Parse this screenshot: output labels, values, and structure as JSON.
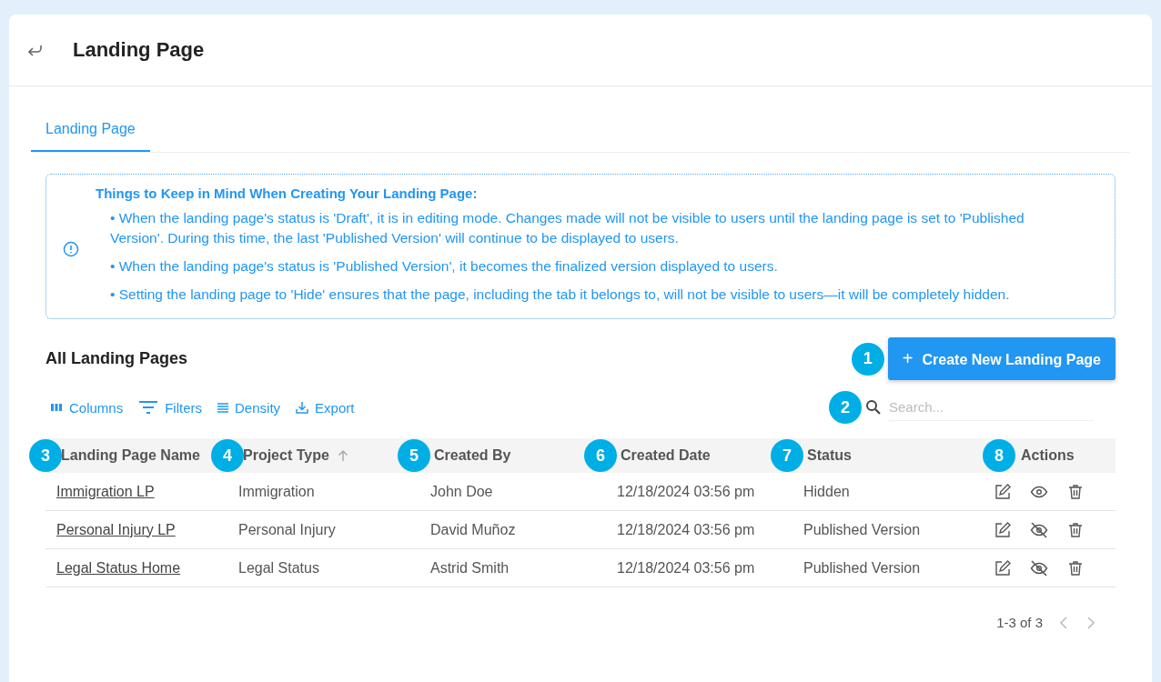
{
  "header": {
    "title": "Landing Page"
  },
  "tabs": [
    {
      "label": "Landing Page",
      "selected": true
    }
  ],
  "notice": {
    "title": "Things to Keep in Mind When Creating Your Landing Page:",
    "items": [
      "• When the landing page's status is 'Draft', it is in editing mode. Changes made will not be visible to users until the landing page is set to 'Published Version'. During this time, the last 'Published Version' will continue to be displayed to users.",
      "• When the landing page's status is 'Published Version', it becomes the finalized version displayed to users.",
      "• Setting the landing page to 'Hide' ensures that the page, including the tab it belongs to, will not be visible to users—it will be completely hidden."
    ]
  },
  "section_title": "All Landing Pages",
  "create_button": {
    "icon": "+",
    "label": "Create New Landing Page",
    "callout": "1"
  },
  "toolbar": [
    {
      "kind": "columns",
      "label": "Columns"
    },
    {
      "kind": "filters",
      "label": "Filters"
    },
    {
      "kind": "density",
      "label": "Density"
    },
    {
      "kind": "export",
      "label": "Export"
    }
  ],
  "search": {
    "placeholder": "Search...",
    "callout": "2"
  },
  "table": {
    "columns": [
      {
        "label": "Landing Page Name",
        "callout": "3",
        "sorted": false
      },
      {
        "label": "Project Type",
        "callout": "4",
        "sorted": true
      },
      {
        "label": "Created By",
        "callout": "5",
        "sorted": false
      },
      {
        "label": "Created Date",
        "callout": "6",
        "sorted": false
      },
      {
        "label": "Status",
        "callout": "7",
        "sorted": false
      },
      {
        "label": "Actions",
        "callout": "8",
        "sorted": false
      }
    ],
    "rows": [
      {
        "name": "Immigration LP",
        "project_type": "Immigration",
        "created_by": "John Doe",
        "created_date": "12/18/2024 03:56 pm",
        "status": "Hidden",
        "visibility_crossed": false
      },
      {
        "name": "Personal Injury LP",
        "project_type": "Personal Injury",
        "created_by": "David Muñoz",
        "created_date": "12/18/2024 03:56 pm",
        "status": "Published Version",
        "visibility_crossed": true
      },
      {
        "name": "Legal Status Home",
        "project_type": "Legal Status",
        "created_by": "Astrid Smith",
        "created_date": "12/18/2024 03:56 pm",
        "status": "Published Version",
        "visibility_crossed": true
      }
    ]
  },
  "pagination": {
    "range": "1-3 of 3"
  }
}
